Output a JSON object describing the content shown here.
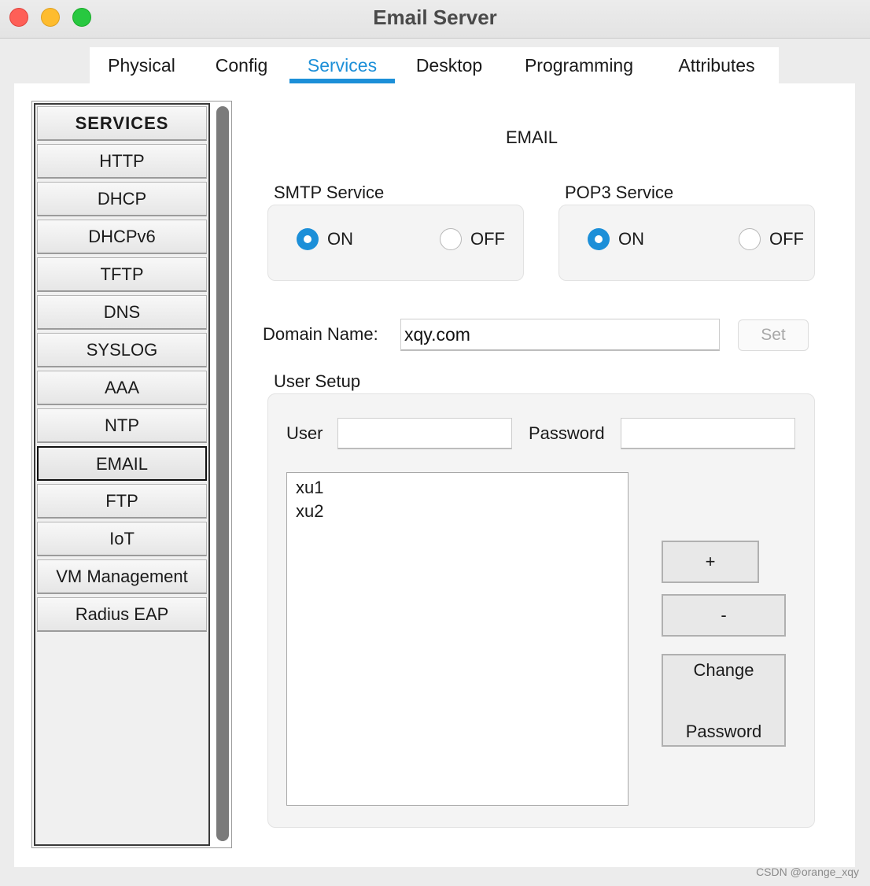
{
  "window": {
    "title": "Email Server"
  },
  "tabs": [
    {
      "label": "Physical"
    },
    {
      "label": "Config"
    },
    {
      "label": "Services",
      "active": true
    },
    {
      "label": "Desktop"
    },
    {
      "label": "Programming"
    },
    {
      "label": "Attributes"
    }
  ],
  "sidebar": {
    "header": "SERVICES",
    "items": [
      {
        "label": "HTTP"
      },
      {
        "label": "DHCP"
      },
      {
        "label": "DHCPv6"
      },
      {
        "label": "TFTP"
      },
      {
        "label": "DNS"
      },
      {
        "label": "SYSLOG"
      },
      {
        "label": "AAA"
      },
      {
        "label": "NTP"
      },
      {
        "label": "EMAIL",
        "selected": true
      },
      {
        "label": "FTP"
      },
      {
        "label": "IoT"
      },
      {
        "label": "VM Management"
      },
      {
        "label": "Radius EAP"
      }
    ]
  },
  "email": {
    "title": "EMAIL",
    "smtp": {
      "label": "SMTP Service",
      "on_label": "ON",
      "off_label": "OFF",
      "selected": "ON"
    },
    "pop3": {
      "label": "POP3 Service",
      "on_label": "ON",
      "off_label": "OFF",
      "selected": "ON"
    },
    "domain": {
      "label": "Domain Name:",
      "value": "xqy.com",
      "set_label": "Set"
    },
    "user_setup": {
      "label": "User Setup",
      "user_label": "User",
      "user_value": "",
      "password_label": "Password",
      "password_value": "",
      "users": [
        "xu1",
        "xu2"
      ],
      "add_label": "+",
      "remove_label": "-",
      "change_line1": "Change",
      "change_line2": "Password"
    }
  },
  "watermark": "CSDN @orange_xqy",
  "colors": {
    "accent": "#1c8fd8",
    "close": "#fe5f57",
    "minimize": "#febc2e",
    "maximize": "#28c840"
  }
}
